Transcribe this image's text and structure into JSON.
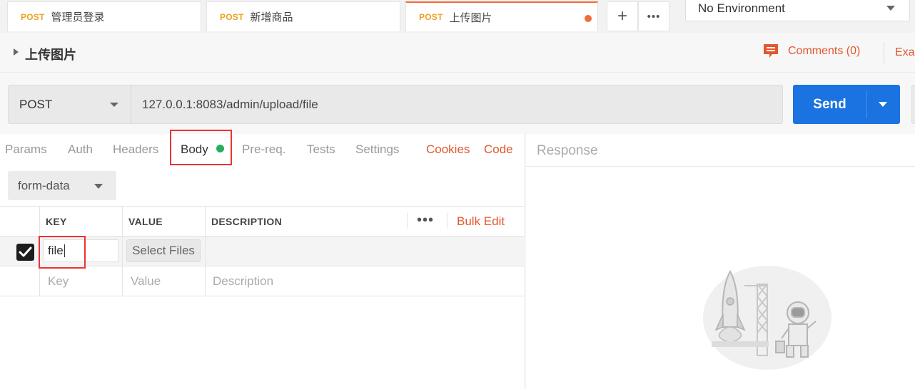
{
  "tabs": [
    {
      "method": "POST",
      "name": "管理员登录"
    },
    {
      "method": "POST",
      "name": "新增商品"
    },
    {
      "method": "POST",
      "name": "上传图片"
    }
  ],
  "tab_actions": {
    "add": "+",
    "more": "•••"
  },
  "environment": {
    "selected": "No Environment"
  },
  "request": {
    "title": "上传图片",
    "comments": "Comments (0)",
    "examples": "Exa",
    "method": "POST",
    "url": "127.0.0.1:8083/admin/upload/file",
    "send_label": "Send"
  },
  "subtabs": {
    "params": "Params",
    "auth": "Auth",
    "headers": "Headers",
    "body": "Body",
    "prereq": "Pre-req.",
    "tests": "Tests",
    "settings": "Settings",
    "cookies": "Cookies",
    "code": "Code"
  },
  "body": {
    "mode": "form-data",
    "columns": {
      "key": "KEY",
      "value": "VALUE",
      "description": "DESCRIPTION"
    },
    "more": "•••",
    "bulk_edit": "Bulk Edit",
    "rows": [
      {
        "key": "file",
        "value_button": "Select Files",
        "checked": true
      }
    ],
    "placeholders": {
      "key": "Key",
      "value": "Value",
      "description": "Description"
    }
  },
  "response": {
    "title": "Response"
  },
  "colors": {
    "accent": "#f26b3a",
    "method_post": "#f0a020",
    "send": "#1a73e0",
    "link": "#e0582d",
    "body_dot": "#27ae60",
    "highlight": "#e33333"
  },
  "icons": [
    "comment-icon",
    "rocket-illustration",
    "astronaut-illustration"
  ]
}
